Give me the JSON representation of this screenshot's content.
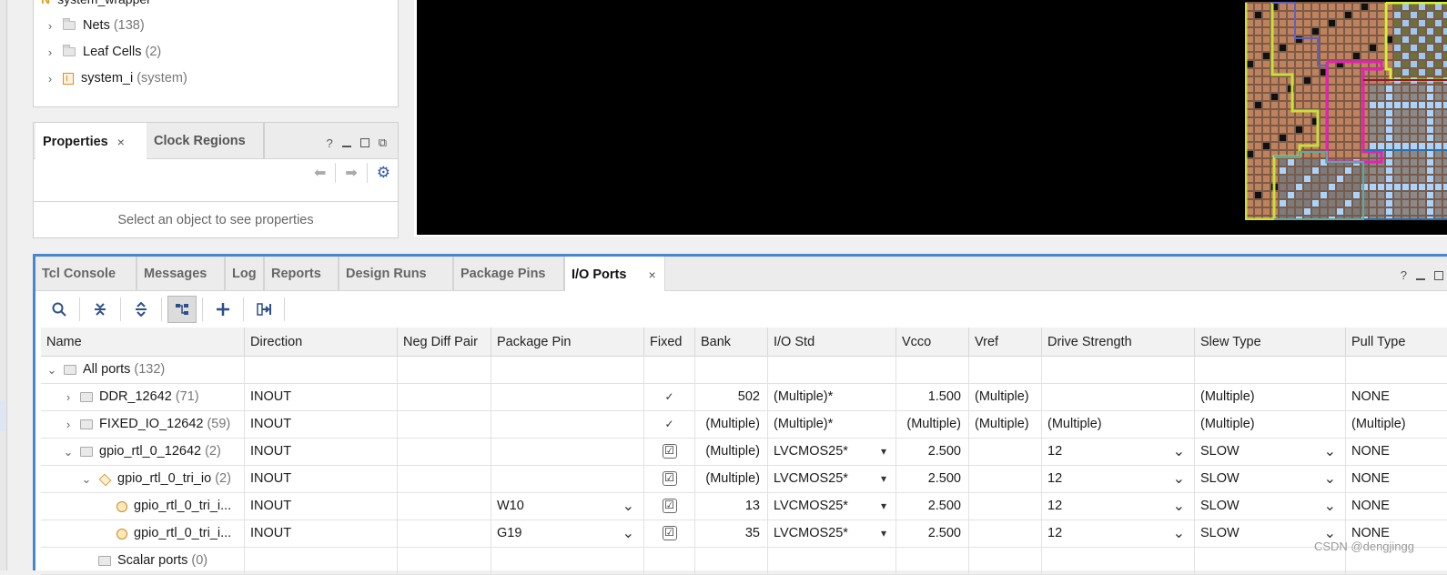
{
  "netlist": {
    "top_item": "system_wrapper",
    "items": [
      {
        "label": "Nets",
        "count": "(138)"
      },
      {
        "label": "Leaf Cells",
        "count": "(2)"
      },
      {
        "label": "system_i",
        "count": "(system)"
      }
    ]
  },
  "properties": {
    "tab_active": "Properties",
    "tab_inactive": "Clock Regions",
    "hint": "Select an object to see properties",
    "help": "?"
  },
  "bottom_tabs": [
    "Tcl Console",
    "Messages",
    "Log",
    "Reports",
    "Design Runs",
    "Package Pins",
    "I/O Ports"
  ],
  "bottom_help": "?",
  "columns": [
    "Name",
    "Direction",
    "Neg Diff Pair",
    "Package Pin",
    "Fixed",
    "Bank",
    "I/O Std",
    "Vcco",
    "Vref",
    "Drive Strength",
    "Slew Type",
    "Pull Type"
  ],
  "rows": [
    {
      "name": "All ports",
      "count": "(132)",
      "direction": "",
      "neg": "",
      "pin": "",
      "fixed": "",
      "bank": "",
      "iostd": "",
      "vcco": "",
      "vref": "",
      "drive": "",
      "slew": "",
      "pull": ""
    },
    {
      "name": "DDR_12642",
      "count": "(71)",
      "direction": "INOUT",
      "neg": "",
      "pin": "",
      "fixed": "✓",
      "bank": "502",
      "iostd": "(Multiple)*",
      "vcco": "1.500",
      "vref": "(Multiple)",
      "drive": "",
      "slew": "(Multiple)",
      "pull": "NONE"
    },
    {
      "name": "FIXED_IO_12642",
      "count": "(59)",
      "direction": "INOUT",
      "neg": "",
      "pin": "",
      "fixed": "✓",
      "bank": "(Multiple)",
      "iostd": "(Multiple)*",
      "vcco": "(Multiple)",
      "vref": "(Multiple)",
      "drive": "(Multiple)",
      "slew": "(Multiple)",
      "pull": "(Multiple)"
    },
    {
      "name": "gpio_rtl_0_12642",
      "count": "(2)",
      "direction": "INOUT",
      "neg": "",
      "pin": "",
      "fixed": "☑",
      "bank": "(Multiple)",
      "iostd": "LVCMOS25*",
      "vcco": "2.500",
      "vref": "",
      "drive": "12",
      "slew": "SLOW",
      "pull": "NONE"
    },
    {
      "name": "gpio_rtl_0_tri_io",
      "count": "(2)",
      "direction": "INOUT",
      "neg": "",
      "pin": "",
      "fixed": "☑",
      "bank": "(Multiple)",
      "iostd": "LVCMOS25*",
      "vcco": "2.500",
      "vref": "",
      "drive": "12",
      "slew": "SLOW",
      "pull": "NONE"
    },
    {
      "name": "gpio_rtl_0_tri_i...",
      "count": "",
      "direction": "INOUT",
      "neg": "",
      "pin": "W10",
      "fixed": "☑",
      "bank": "13",
      "iostd": "LVCMOS25*",
      "vcco": "2.500",
      "vref": "",
      "drive": "12",
      "slew": "SLOW",
      "pull": "NONE"
    },
    {
      "name": "gpio_rtl_0_tri_i...",
      "count": "",
      "direction": "INOUT",
      "neg": "",
      "pin": "G19",
      "fixed": "☑",
      "bank": "35",
      "iostd": "LVCMOS25*",
      "vcco": "2.500",
      "vref": "",
      "drive": "12",
      "slew": "SLOW",
      "pull": "NONE"
    },
    {
      "name": "Scalar ports",
      "count": "(0)",
      "direction": "",
      "neg": "",
      "pin": "",
      "fixed": "",
      "bank": "",
      "iostd": "",
      "vcco": "",
      "vref": "",
      "drive": "",
      "slew": "",
      "pull": ""
    }
  ],
  "watermark": "CSDN @dengjingg",
  "colors": {
    "accent": "#4a86d0",
    "device_bg": "#000000"
  }
}
